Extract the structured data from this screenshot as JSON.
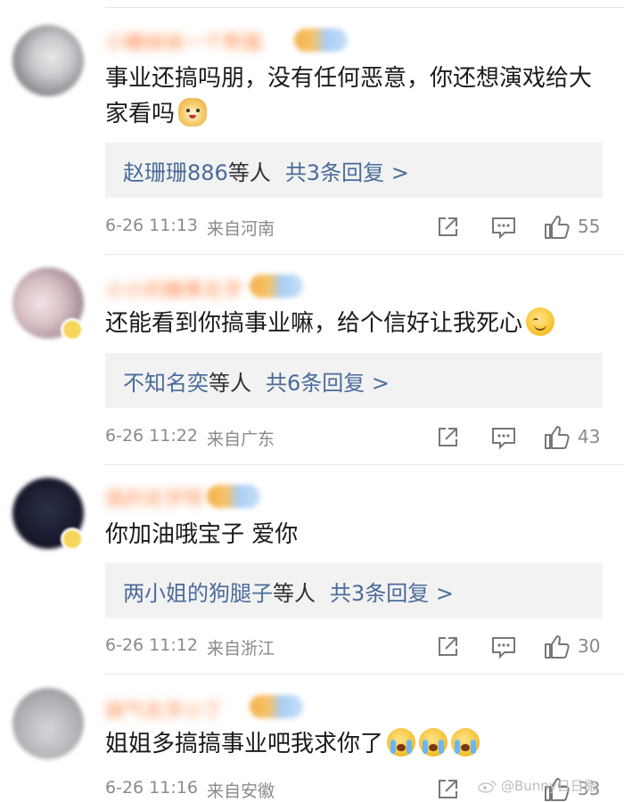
{
  "comments": [
    {
      "username": "小糖妹妹一个熊猫",
      "text": "事业还搞吗朋，没有任何恶意，你还想演戏给大家看吗",
      "emoji": "dog-emoji",
      "replies": {
        "who": "赵珊珊886",
        "deng": "等人",
        "count": "共3条回复 >"
      },
      "time": "6-26 11:13",
      "location": "来自河南",
      "likes": "55"
    },
    {
      "username": "小小的糖果名字",
      "text": "还能看到你搞事业嘛，给个信好让我死心",
      "emoji": "smile-emoji",
      "replies": {
        "who": "不知名奕",
        "deng": "等人",
        "count": "共6条回复 >"
      },
      "time": "6-26 11:22",
      "location": "来自广东",
      "likes": "43"
    },
    {
      "username": "我的名字呀",
      "text": "你加油哦宝子 爱你",
      "emoji": "",
      "replies": {
        "who": "两小姐的狗腿子",
        "deng": "等人",
        "count": "共3条回复 >"
      },
      "time": "6-26 11:12",
      "location": "来自浙江",
      "likes": "30"
    },
    {
      "username": "娘气名字小丁",
      "text": "姐姐多搞搞事业吧我求你了",
      "emoji": "crying-emoji",
      "replies": null,
      "time": "6-26 11:16",
      "location": "来自安徽",
      "likes": "33"
    }
  ],
  "watermark": "@Bunny日日撒",
  "colors": {
    "link": "#4a6b9a",
    "meta": "#8a8a8a",
    "username": "#ff8a4c",
    "reply_bg": "#f2f2f2"
  }
}
